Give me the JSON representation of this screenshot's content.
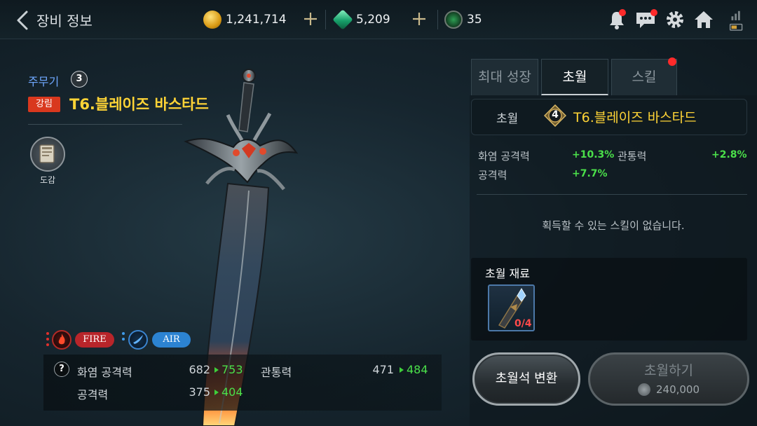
{
  "header": {
    "title": "장비 정보",
    "gold": "1,241,714",
    "gem": "5,209",
    "energy": "35"
  },
  "item": {
    "slot_label": "주무기",
    "slot_level": "3",
    "grade_tag": "강림",
    "name": "T6.블레이즈 바스타드",
    "dogam_label": "도감"
  },
  "elements": [
    {
      "name": "FIRE",
      "color": "#c0262a"
    },
    {
      "name": "AIR",
      "color": "#2f86d6"
    }
  ],
  "stats": {
    "help_icon": "?",
    "rows": [
      {
        "label": "화염 공격력",
        "old": "682",
        "new": "753"
      },
      {
        "label": "공격력",
        "old": "375",
        "new": "404"
      },
      {
        "label": "관통력",
        "old": "471",
        "new": "484"
      }
    ]
  },
  "tabs": [
    {
      "label": "최대 성장"
    },
    {
      "label": "초월"
    },
    {
      "label": "스킬"
    }
  ],
  "transcend": {
    "label": "초월",
    "level": "4",
    "name": "T6.블레이즈 바스타드",
    "bonuses": [
      {
        "label": "화염 공격력",
        "value": "+10.3%"
      },
      {
        "label": "관통력",
        "value": "+2.8%"
      },
      {
        "label": "공격력",
        "value": "+7.7%"
      }
    ],
    "no_skill_text": "획득할 수 있는 스킬이 없습니다.",
    "materials_title": "초월 재료",
    "material_count": "0/4"
  },
  "buttons": {
    "convert": "초월석 변환",
    "execute": "초월하기",
    "cost": "240,000"
  },
  "colors": {
    "gold_text": "#ffd436",
    "gain_green": "#4be04a",
    "notify_red": "#ff2a2a"
  }
}
